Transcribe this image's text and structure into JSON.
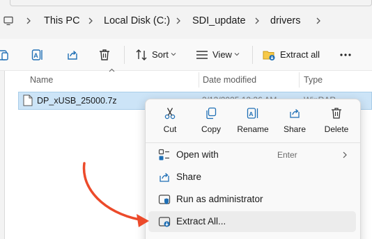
{
  "address_bar": {
    "crumbs": [
      "This PC",
      "Local Disk (C:)",
      "SDI_update",
      "drivers"
    ]
  },
  "toolbar": {
    "sort_label": "Sort",
    "view_label": "View",
    "extract_all_label": "Extract all"
  },
  "columns": {
    "name": "Name",
    "date_modified": "Date modified",
    "type": "Type"
  },
  "file": {
    "name": "DP_xUSB_25000.7z",
    "date_partial": "3/13/2025 12:36 AM",
    "type_partial": "WinRAR"
  },
  "context_menu": {
    "quick_actions": [
      {
        "label": "Cut",
        "icon": "cut-icon"
      },
      {
        "label": "Copy",
        "icon": "copy-icon"
      },
      {
        "label": "Rename",
        "icon": "rename-icon"
      },
      {
        "label": "Share",
        "icon": "share-icon"
      },
      {
        "label": "Delete",
        "icon": "delete-icon"
      }
    ],
    "items": [
      {
        "label": "Open with",
        "accelerator": "Enter",
        "icon": "open-with-icon"
      },
      {
        "label": "Share",
        "icon": "share-icon"
      },
      {
        "label": "Run as administrator",
        "icon": "shield-icon"
      },
      {
        "label": "Extract All...",
        "icon": "extract-icon"
      }
    ]
  },
  "colors": {
    "selection": "#cce4f7",
    "accent": "#0067c0",
    "arrow": "#ec4a2a"
  }
}
